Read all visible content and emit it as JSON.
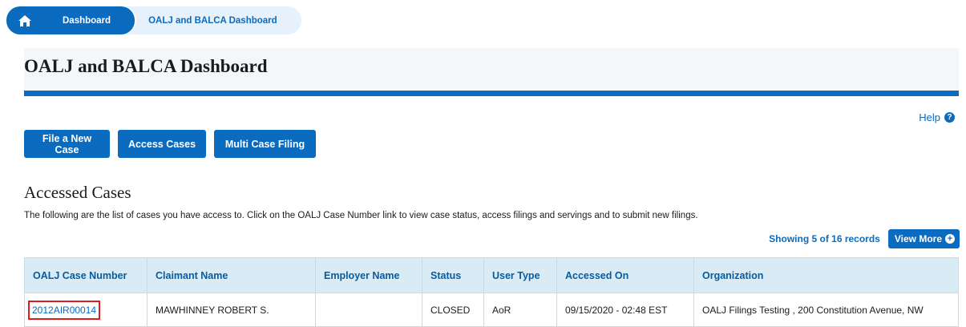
{
  "breadcrumb": {
    "home_icon": "home-icon",
    "items": [
      "Dashboard",
      "OALJ and BALCA Dashboard"
    ]
  },
  "page": {
    "title": "OALJ and BALCA Dashboard",
    "help_label": "Help",
    "help_icon": "question-circle-icon"
  },
  "actions": {
    "file_new_case": "File a New Case",
    "access_cases": "Access Cases",
    "multi_case_filing": "Multi Case Filing"
  },
  "accessed_cases": {
    "title": "Accessed Cases",
    "description": "The following are the list of cases you have access to. Click on the OALJ Case Number link to view case status, access filings and servings and to submit new filings.",
    "showing": "Showing 5 of 16 records",
    "view_more": "View More",
    "view_more_icon": "plus-circle-icon",
    "columns": [
      "OALJ Case Number",
      "Claimant Name",
      "Employer Name",
      "Status",
      "User Type",
      "Accessed On",
      "Organization"
    ],
    "rows": [
      [
        "2012AIR00014",
        "MAWHINNEY ROBERT S.",
        "",
        "CLOSED",
        "AoR",
        "09/15/2020 - 02:48 EST",
        "OALJ Filings Testing , 200 Constitution Avenue, NW"
      ]
    ]
  },
  "colors": {
    "primary": "#0a6bbf",
    "header_bg": "#d9ecf5",
    "highlight": "#e01b1b"
  }
}
